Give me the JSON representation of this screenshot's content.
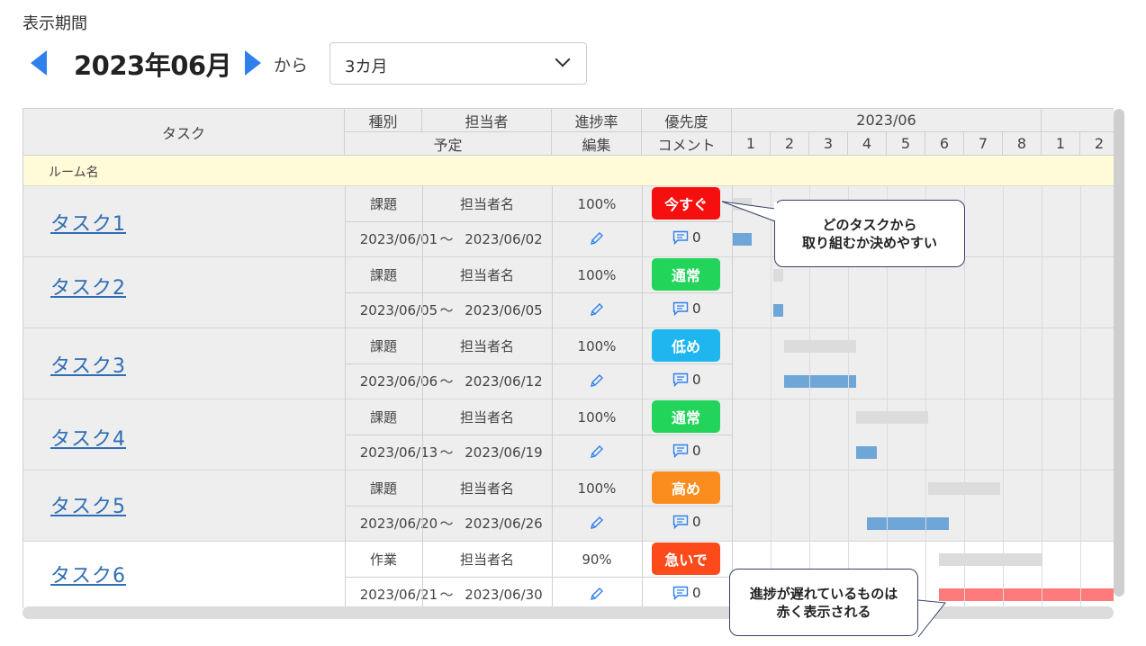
{
  "period": {
    "label": "表示期間",
    "month": "2023年06月",
    "from": "から",
    "range_select": "3カ月"
  },
  "header": {
    "task": "タスク",
    "type": "種別",
    "assignee": "担当者",
    "progress": "進捗率",
    "priority": "優先度",
    "schedule": "予定",
    "edit": "編集",
    "comment": "コメント",
    "month": "2023/06",
    "days": [
      "1",
      "2",
      "3",
      "4",
      "5",
      "6",
      "7",
      "8",
      "1",
      "2"
    ]
  },
  "room": {
    "name": "ルーム名"
  },
  "tasks": [
    {
      "name": "タスク1",
      "type": "課題",
      "assignee": "担当者名",
      "progress": "100%",
      "priority": "今すぐ",
      "priority_color": "#f50f0f",
      "start": "2023/06/01",
      "tilde": "〜",
      "end": "2023/06/02",
      "comments": "0"
    },
    {
      "name": "タスク2",
      "type": "課題",
      "assignee": "担当者名",
      "progress": "100%",
      "priority": "通常",
      "priority_color": "#22d45a",
      "start": "2023/06/05",
      "tilde": "〜",
      "end": "2023/06/05",
      "comments": "0"
    },
    {
      "name": "タスク3",
      "type": "課題",
      "assignee": "担当者名",
      "progress": "100%",
      "priority": "低め",
      "priority_color": "#1fb6f0",
      "start": "2023/06/06",
      "tilde": "〜",
      "end": "2023/06/12",
      "comments": "0"
    },
    {
      "name": "タスク4",
      "type": "課題",
      "assignee": "担当者名",
      "progress": "100%",
      "priority": "通常",
      "priority_color": "#22d45a",
      "start": "2023/06/13",
      "tilde": "〜",
      "end": "2023/06/19",
      "comments": "0"
    },
    {
      "name": "タスク5",
      "type": "課題",
      "assignee": "担当者名",
      "progress": "100%",
      "priority": "高め",
      "priority_color": "#fb8c1e",
      "start": "2023/06/20",
      "tilde": "〜",
      "end": "2023/06/26",
      "comments": "0"
    },
    {
      "name": "タスク6",
      "type": "作業",
      "assignee": "担当者名",
      "progress": "90%",
      "priority": "急いで",
      "priority_color": "#fc4a1a",
      "start": "2023/06/21",
      "tilde": "〜",
      "end": "2023/06/30",
      "comments": "0"
    }
  ],
  "callouts": {
    "top_line1": "どのタスクから",
    "top_line2": "取り組むか決めやすい",
    "bottom_line1": "進捗が遅れているものは",
    "bottom_line2": "赤く表示される"
  },
  "colors": {
    "accent": "#2f80ed",
    "link": "#2f6eb5",
    "plan_bar": "#dcdcdc",
    "actual_bar": "#6ea6d8",
    "late_bar": "#ff7b7b",
    "room_bg": "#fffbd8"
  }
}
